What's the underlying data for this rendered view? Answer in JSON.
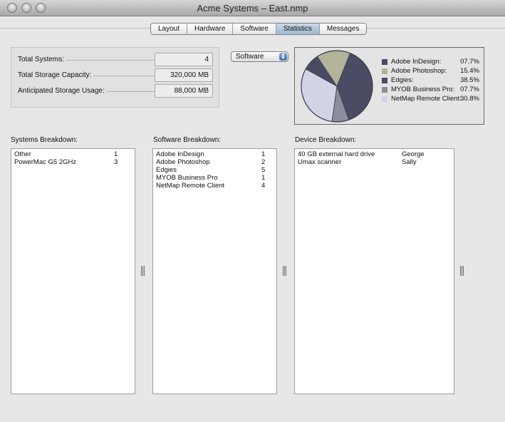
{
  "window": {
    "title": "Acme Systems – East.nmp"
  },
  "tabs": [
    {
      "label": "Layout"
    },
    {
      "label": "Hardware"
    },
    {
      "label": "Software"
    },
    {
      "label": "Statistics"
    },
    {
      "label": "Messages"
    }
  ],
  "active_tab": "Statistics",
  "stats": [
    {
      "label": "Total Systems:",
      "value": "4"
    },
    {
      "label": "Total Storage Capacity:",
      "value": "320,000 MB"
    },
    {
      "label": "Anticipated Storage Usage:",
      "value": "88,000 MB"
    }
  ],
  "chart_selector": {
    "value": "Software"
  },
  "chart_data": {
    "type": "pie",
    "slices": [
      {
        "label": "Adobe InDesign:",
        "display": "07.7%",
        "value": 7.7,
        "color": "#4a4a62"
      },
      {
        "label": "Adobe Photoshop:",
        "display": "15.4%",
        "value": 15.4,
        "color": "#b3b39c"
      },
      {
        "label": "Edgies:",
        "display": "38.5%",
        "value": 38.5,
        "color": "#4b4b63"
      },
      {
        "label": "MYOB Business Pro:",
        "display": "07.7%",
        "value": 7.7,
        "color": "#8c8c9e"
      },
      {
        "label": "NetMap Remote Client:",
        "display": "30.8%",
        "value": 30.8,
        "color": "#d3d3e6"
      }
    ]
  },
  "systems": {
    "label": "Systems Breakdown:",
    "items": [
      {
        "name": "Other",
        "count": "1"
      },
      {
        "name": "PowerMac G5 2GHz",
        "count": "3"
      }
    ]
  },
  "software": {
    "label": "Software Breakdown:",
    "items": [
      {
        "name": "Adobe InDesign",
        "count": "1"
      },
      {
        "name": "Adobe Photoshop",
        "count": "2"
      },
      {
        "name": "Edgies",
        "count": "5"
      },
      {
        "name": "MYOB Business Pro",
        "count": "1"
      },
      {
        "name": "NetMap Remote Client",
        "count": "4"
      }
    ]
  },
  "devices": {
    "label": "Device Breakdown:",
    "items": [
      {
        "name": "40 GB external hard drive",
        "owner": "George"
      },
      {
        "name": "Umax scanner",
        "owner": "Sally"
      }
    ]
  }
}
